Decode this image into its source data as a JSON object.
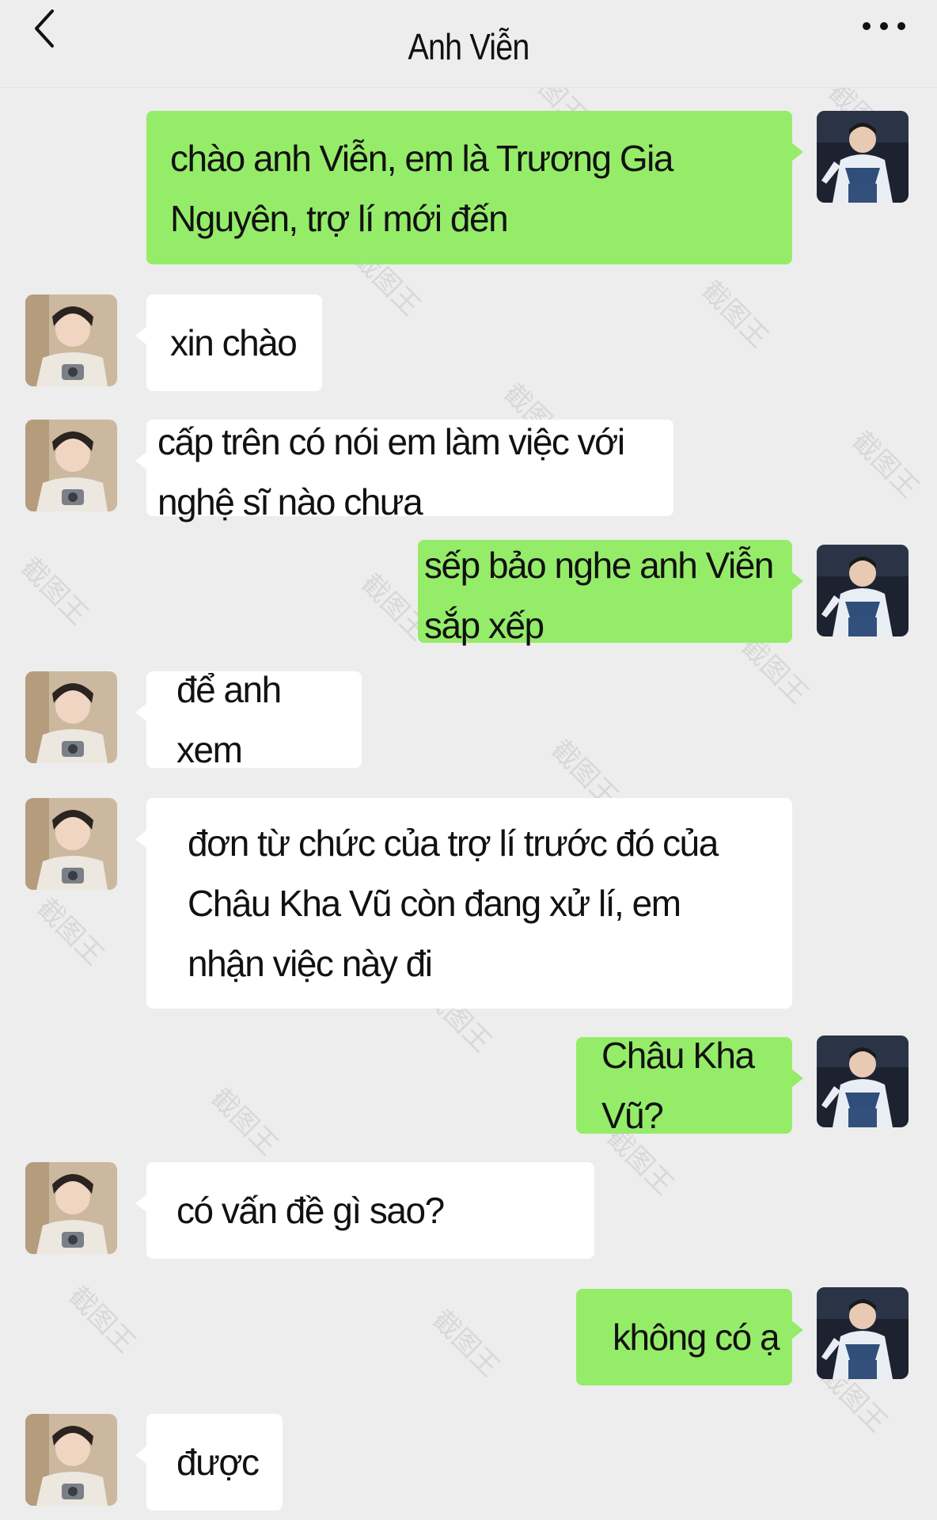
{
  "header": {
    "title": "Anh Viễn"
  },
  "watermark": "截图王",
  "icons": {
    "back": "chevron-left-icon",
    "more": "more-dots-icon"
  },
  "colors": {
    "sent_bubble": "#95ec69",
    "received_bubble": "#ffffff",
    "background": "#ededed"
  },
  "messages": [
    {
      "sender": "me",
      "text": "chào anh Viễn, em là Trương Gia Nguyên, trợ lí mới đến"
    },
    {
      "sender": "other",
      "text": "xin chào"
    },
    {
      "sender": "other",
      "text": "cấp trên có nói em làm việc với nghệ sĩ nào chưa"
    },
    {
      "sender": "me",
      "text": "sếp bảo nghe anh Viễn sắp xếp"
    },
    {
      "sender": "other",
      "text": "để anh xem"
    },
    {
      "sender": "other",
      "text": "đơn từ chức của trợ lí trước đó của Châu Kha Vũ còn đang xử lí, em nhận việc này đi"
    },
    {
      "sender": "me",
      "text": "Châu Kha Vũ?"
    },
    {
      "sender": "other",
      "text": "có vấn đề gì sao?"
    },
    {
      "sender": "me",
      "text": "không có ạ"
    },
    {
      "sender": "other",
      "text": "được"
    }
  ]
}
